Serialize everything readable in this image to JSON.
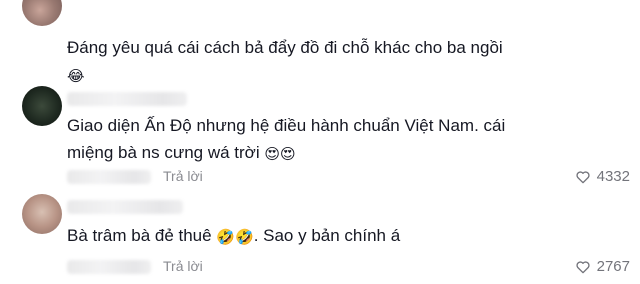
{
  "comments": [
    {
      "text": "Đáng yêu quá cái cách bả đẩy đồ đi chỗ khác cho ba ngồi",
      "emoji": "😂"
    },
    {
      "text_line1": "Giao diện Ấn Độ nhưng hệ điều hành chuẩn Việt Nam. cái",
      "text_line2": "miệng bà ns cưng wá trời",
      "emoji": "😍😍",
      "reply_label": "Trả lời",
      "likes": "4332"
    },
    {
      "text": "Bà trâm bà đẻ thuê",
      "emoji": "🤣🤣",
      "text_after": ". Sao y bản chính á",
      "reply_label": "Trả lời",
      "likes": "2767"
    }
  ],
  "icons": {
    "like": "heart-outline-icon"
  },
  "colors": {
    "text": "#161823",
    "meta": "#8a8b91",
    "like": "#73747b"
  }
}
